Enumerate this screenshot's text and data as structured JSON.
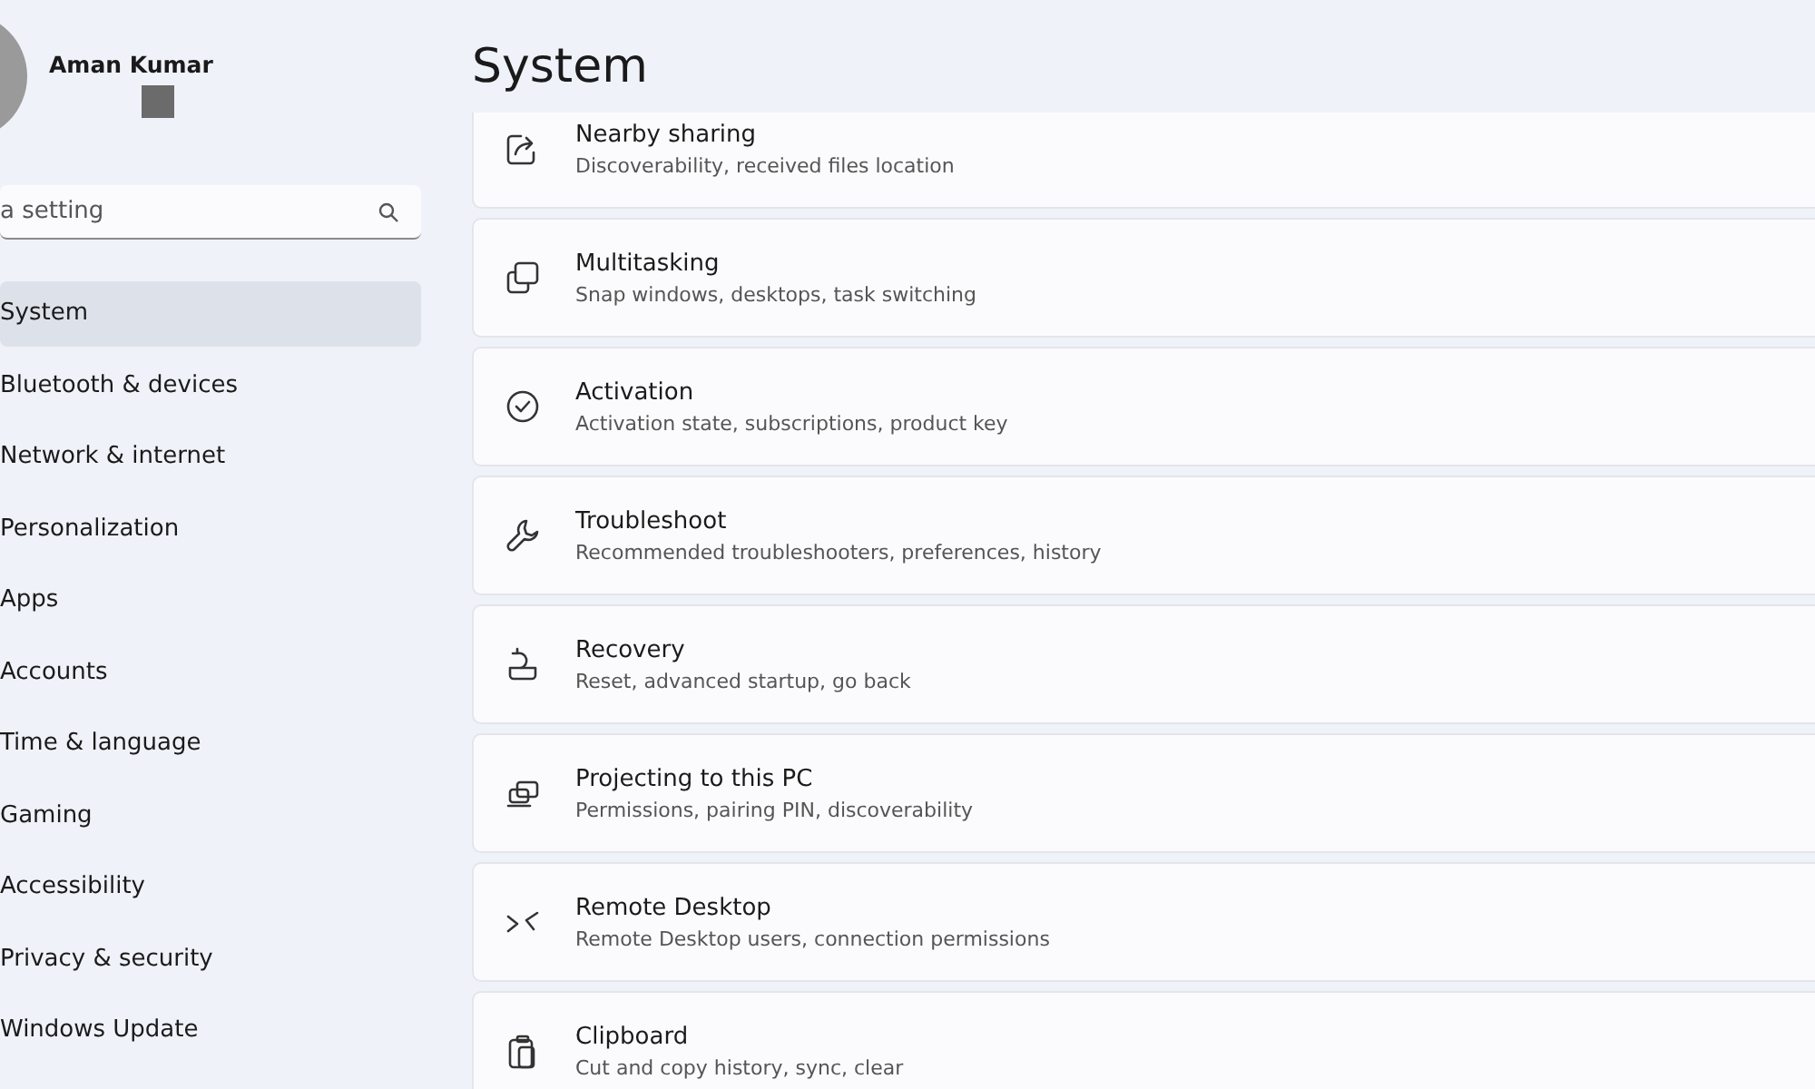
{
  "sidebar": {
    "user": {
      "name": "Aman Kumar"
    },
    "search": {
      "placeholder": "a setting"
    },
    "items": [
      {
        "label": "System",
        "selected": true
      },
      {
        "label": "Bluetooth & devices",
        "selected": false
      },
      {
        "label": "Network & internet",
        "selected": false
      },
      {
        "label": "Personalization",
        "selected": false
      },
      {
        "label": "Apps",
        "selected": false
      },
      {
        "label": "Accounts",
        "selected": false
      },
      {
        "label": "Time & language",
        "selected": false
      },
      {
        "label": "Gaming",
        "selected": false
      },
      {
        "label": "Accessibility",
        "selected": false
      },
      {
        "label": "Privacy & security",
        "selected": false
      },
      {
        "label": "Windows Update",
        "selected": false
      }
    ]
  },
  "page": {
    "title": "System",
    "settings": [
      {
        "kind": "share",
        "title": "Nearby sharing",
        "description": "Discoverability, received files location"
      },
      {
        "kind": "multitask",
        "title": "Multitasking",
        "description": "Snap windows, desktops, task switching"
      },
      {
        "kind": "activation",
        "title": "Activation",
        "description": "Activation state, subscriptions, product key"
      },
      {
        "kind": "troubleshoot",
        "title": "Troubleshoot",
        "description": "Recommended troubleshooters, preferences, history"
      },
      {
        "kind": "recovery",
        "title": "Recovery",
        "description": "Reset, advanced startup, go back"
      },
      {
        "kind": "projecting",
        "title": "Projecting to this PC",
        "description": "Permissions, pairing PIN, discoverability"
      },
      {
        "kind": "remote",
        "title": "Remote Desktop",
        "description": "Remote Desktop users, connection permissions"
      },
      {
        "kind": "clipboard",
        "title": "Clipboard",
        "description": "Cut and copy history, sync, clear"
      }
    ]
  }
}
